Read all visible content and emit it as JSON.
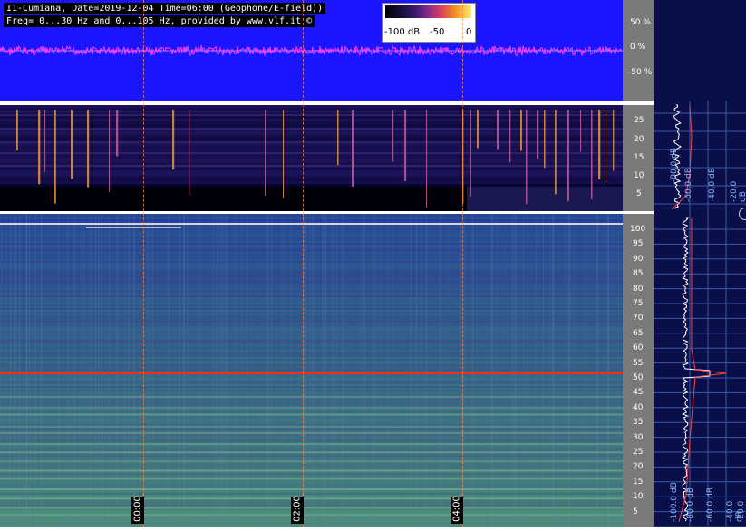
{
  "header": {
    "line1": "I1-Cumiana, Date=2019-12-04 Time=06:00 (Geophone/E-field))",
    "line2": "Freq= 0...30 Hz and 0...105 Hz, provided by www.vlf.it ©"
  },
  "colorbar": {
    "labels": [
      "-100 dB",
      "-50",
      "0"
    ]
  },
  "wave_scale": {
    "labels": [
      "50 %",
      "0 %",
      "-50 %"
    ]
  },
  "spec1_scale": {
    "labels": [
      "25",
      "20",
      "15",
      "10",
      "5"
    ]
  },
  "spec2_scale": {
    "labels": [
      "100",
      "95",
      "90",
      "85",
      "80",
      "75",
      "70",
      "65",
      "60",
      "55",
      "50",
      "45",
      "40",
      "35",
      "30",
      "25",
      "20",
      "15",
      "10",
      "5"
    ]
  },
  "spectrum1_db_labels": [
    "-80.0 dB",
    "-60.0 dB",
    "-40.0 dB",
    "-20.0 dB"
  ],
  "spectrum2_db_labels": [
    "-100.0 dB",
    "-80.0 dB",
    "-60.0 dB",
    "-40.0 dB",
    "-20.0 dB"
  ],
  "time_labels": [
    "00:00",
    "02:00",
    "04:00"
  ],
  "colors": {
    "wave_bg": "#1a14ff",
    "wave_trace": "#ff40ff",
    "marker": "#ff8844",
    "side_panel": "#0a0f4a",
    "scale_bg": "#7a7a7a"
  }
}
